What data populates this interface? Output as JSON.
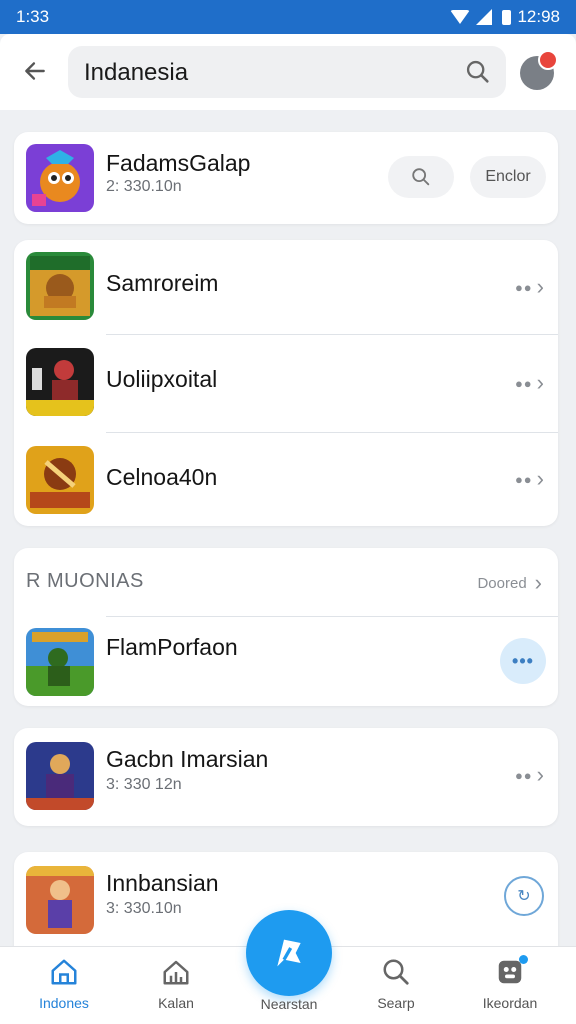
{
  "status_bar": {
    "time": "1:33",
    "right_text": "12:98"
  },
  "search": {
    "query": "Indanesia"
  },
  "colors": {
    "accent": "#1e9bf0",
    "status_bar": "#1f6ec9",
    "badge": "#e8453c"
  },
  "top_card": {
    "title": "FadamsGalap",
    "subtitle": "2: 330.10n",
    "action_label": "Enclor",
    "icon": "search-icon"
  },
  "group_list": {
    "items": [
      {
        "title": "Samroreim"
      },
      {
        "title": "Uoliipxoital"
      },
      {
        "title": "Celnoa40n"
      }
    ]
  },
  "section": {
    "header": "R MUONIAS",
    "link_label": "Doored",
    "item": {
      "title": "FlamPorfaon"
    }
  },
  "card_gacbn": {
    "title": "Gacbn Imarsian",
    "subtitle": "3: 330 12n"
  },
  "card_innbansian": {
    "title": "Innbansian",
    "subtitle": "3: 330.10n"
  },
  "bottom_nav": {
    "items": [
      {
        "label": "Indones",
        "icon": "home-icon"
      },
      {
        "label": "Kalan",
        "icon": "house-chart-icon"
      },
      {
        "label": "Nearstan",
        "icon": "flag-icon"
      },
      {
        "label": "Searp",
        "icon": "search-icon"
      },
      {
        "label": "Ikeordan",
        "icon": "game-icon"
      }
    ]
  }
}
